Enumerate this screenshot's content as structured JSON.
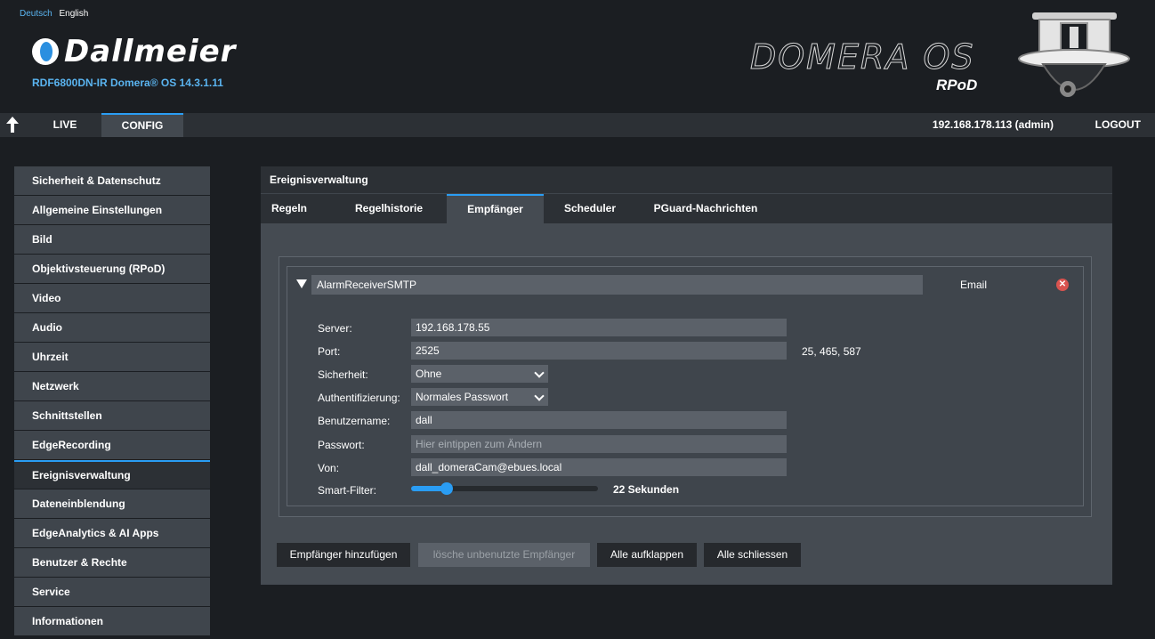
{
  "header": {
    "languages": [
      "Deutsch",
      "English"
    ],
    "logo_text": "Dallmeier",
    "model": "RDF6800DN-IR  Domera® OS 14.3.1.11",
    "product_logo": "DOMERA OS",
    "product_sub": "RPoD"
  },
  "nav": {
    "live": "LIVE",
    "config": "CONFIG",
    "host": "192.168.178.113 (admin)",
    "logout": "LOGOUT"
  },
  "sidebar": {
    "items": [
      "Sicherheit & Datenschutz",
      "Allgemeine Einstellungen",
      "Bild",
      "Objektivsteuerung (RPoD)",
      "Video",
      "Audio",
      "Uhrzeit",
      "Netzwerk",
      "Schnittstellen",
      "EdgeRecording",
      "Ereignisverwaltung",
      "Dateneinblendung",
      "EdgeAnalytics & AI Apps",
      "Benutzer & Rechte",
      "Service",
      "Informationen"
    ],
    "active_index": 10
  },
  "panel": {
    "title": "Ereignisverwaltung",
    "tabs": [
      "Regeln",
      "Regelhistorie",
      "Empfänger",
      "Scheduler",
      "PGuard-Nachrichten"
    ],
    "active_tab": 2
  },
  "receiver": {
    "name": "AlarmReceiverSMTP",
    "type": "Email",
    "server_label": "Server:",
    "server": "192.168.178.55",
    "port_label": "Port:",
    "port": "2525",
    "port_hint": "25, 465, 587",
    "security_label": "Sicherheit:",
    "security": "Ohne",
    "auth_label": "Authentifizierung:",
    "auth": "Normales Passwort",
    "user_label": "Benutzername:",
    "user": "dall",
    "password_label": "Passwort:",
    "password_placeholder": "Hier eintippen zum Ändern",
    "from_label": "Von:",
    "from": "dall_domeraCam@ebues.local",
    "filter_label": "Smart-Filter:",
    "filter_value": "22 Sekunden",
    "filter_fraction": 0.19
  },
  "buttons": {
    "add": "Empfänger hinzufügen",
    "delete_unused": "lösche unbenutzte Empfänger",
    "expand_all": "Alle aufklappen",
    "collapse_all": "Alle schliessen"
  },
  "colors": {
    "accent": "#2a9df4",
    "model_text": "#5ab4f0",
    "delete": "#d9534f"
  }
}
